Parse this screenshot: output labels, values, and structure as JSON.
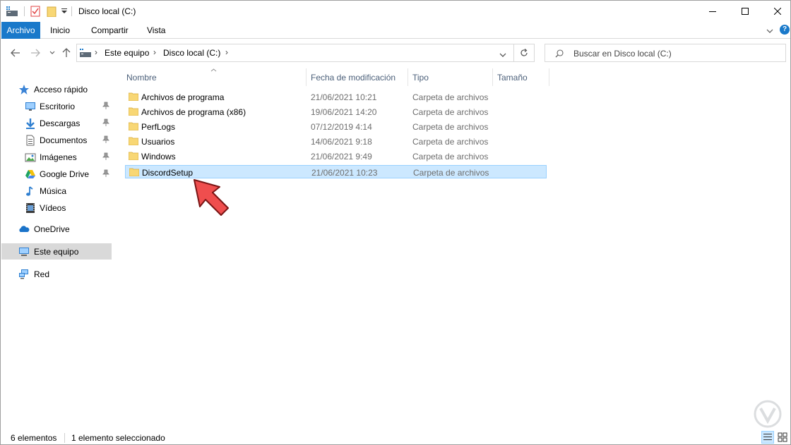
{
  "window": {
    "title": "Disco local (C:)"
  },
  "ribbon": {
    "tabs": [
      "Archivo",
      "Inicio",
      "Compartir",
      "Vista"
    ]
  },
  "address": {
    "crumbs": [
      "Este equipo",
      "Disco local (C:)"
    ]
  },
  "search": {
    "placeholder": "Buscar en Disco local (C:)"
  },
  "nav": {
    "quick_access": "Acceso rápido",
    "items": [
      {
        "label": "Escritorio",
        "icon": "desktop-icon",
        "pinned": true
      },
      {
        "label": "Descargas",
        "icon": "download-icon",
        "pinned": true
      },
      {
        "label": "Documentos",
        "icon": "document-icon",
        "pinned": true
      },
      {
        "label": "Imágenes",
        "icon": "pictures-icon",
        "pinned": true
      },
      {
        "label": "Google Drive",
        "icon": "google-drive-icon",
        "pinned": true
      },
      {
        "label": "Música",
        "icon": "music-icon",
        "pinned": false
      },
      {
        "label": "Vídeos",
        "icon": "video-icon",
        "pinned": false
      }
    ],
    "onedrive": "OneDrive",
    "this_pc": "Este equipo",
    "network": "Red"
  },
  "columns": {
    "name": "Nombre",
    "date": "Fecha de modificación",
    "type": "Tipo",
    "size": "Tamaño"
  },
  "files": [
    {
      "name": "Archivos de programa",
      "date": "21/06/2021 10:21",
      "type": "Carpeta de archivos"
    },
    {
      "name": "Archivos de programa (x86)",
      "date": "19/06/2021 14:20",
      "type": "Carpeta de archivos"
    },
    {
      "name": "PerfLogs",
      "date": "07/12/2019 4:14",
      "type": "Carpeta de archivos"
    },
    {
      "name": "Usuarios",
      "date": "14/06/2021 9:18",
      "type": "Carpeta de archivos"
    },
    {
      "name": "Windows",
      "date": "21/06/2021 9:49",
      "type": "Carpeta de archivos"
    },
    {
      "name": "DiscordSetup",
      "date": "21/06/2021 10:23",
      "type": "Carpeta de archivos"
    }
  ],
  "status": {
    "count": "6 elementos",
    "selection": "1 elemento seleccionado"
  },
  "colors": {
    "accent": "#1979ca",
    "selection_bg": "#cce8ff",
    "selection_border": "#99d1ff",
    "folder": "#f8d775",
    "arrow": "#ef4e4e"
  }
}
